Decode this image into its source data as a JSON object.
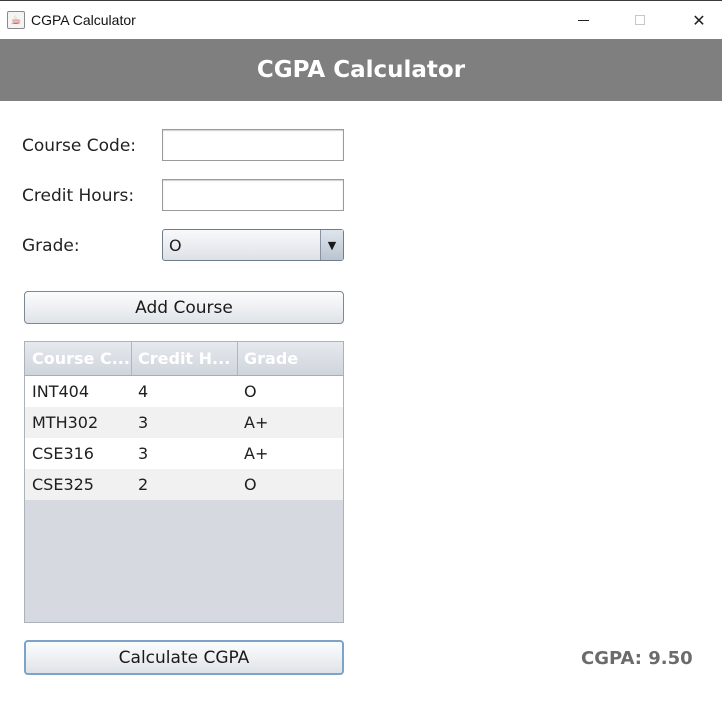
{
  "window": {
    "title": "CGPA Calculator",
    "icon": "java-cup-icon",
    "minimize_glyph": "minimize-icon",
    "maximize_glyph": "maximize-icon",
    "close_glyph": "✕"
  },
  "header": {
    "title": "CGPA Calculator",
    "background": "#7f7f7f"
  },
  "form": {
    "course_code_label": "Course Code:",
    "course_code_value": "",
    "credit_hours_label": "Credit Hours:",
    "credit_hours_value": "",
    "grade_label": "Grade:",
    "grade_value": "O",
    "grade_arrow": "▼"
  },
  "buttons": {
    "add_course": "Add Course",
    "calculate": "Calculate CGPA"
  },
  "table": {
    "headers": [
      "Course C...",
      "Credit H...",
      "Grade"
    ],
    "rows": [
      [
        "INT404",
        "4",
        "O"
      ],
      [
        "MTH302",
        "3",
        "A+"
      ],
      [
        "CSE316",
        "3",
        "A+"
      ],
      [
        "CSE325",
        "2",
        "O"
      ]
    ]
  },
  "result": {
    "text": "CGPA: 9.50"
  }
}
